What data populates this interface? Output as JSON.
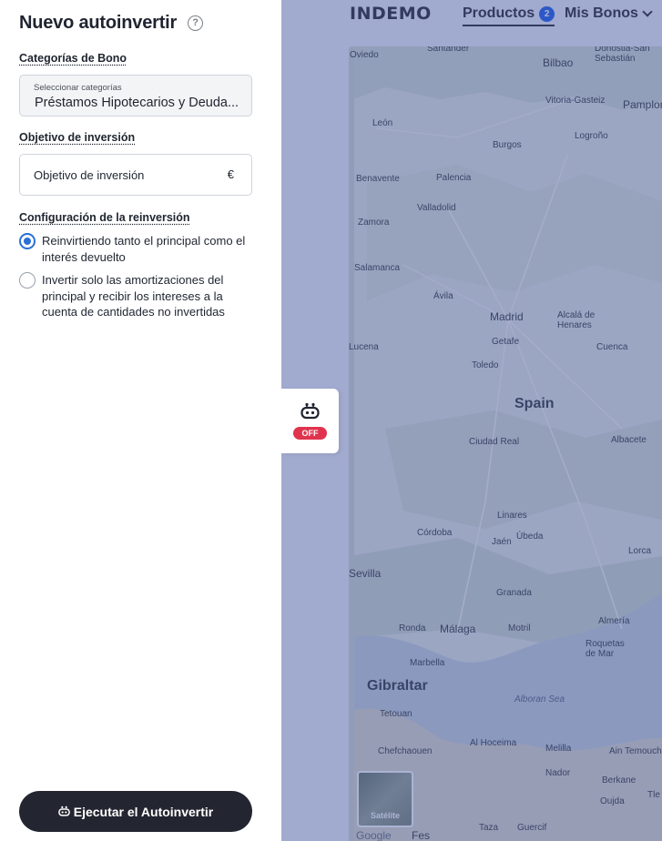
{
  "header": {
    "logo": "INDEMO",
    "nav_productos": "Productos",
    "productos_badge": "2",
    "nav_mis_bonos": "Mis Bonos"
  },
  "panel": {
    "title": "Nuevo autoinvertir",
    "help_icon": "?",
    "categorias": {
      "label": "Categorías de Bono",
      "caption": "Seleccionar categorías",
      "value": "Préstamos Hipotecarios y Deuda..."
    },
    "objetivo": {
      "label": "Objetivo de inversión",
      "placeholder": "Objetivo de inversión",
      "unit": "€"
    },
    "reinversion": {
      "label": "Configuración de la reinversión",
      "options": [
        {
          "text": "Reinvirtiendo tanto el principal como el interés devuelto",
          "selected": true
        },
        {
          "text": "Invertir solo las amortizaciones del principal y recibir los intereses a la cuenta de cantidades no invertidas",
          "selected": false
        }
      ]
    },
    "execute_button": "Ejecutar el Autoinvertir"
  },
  "bot_toggle": {
    "status": "OFF"
  },
  "map": {
    "country": "Spain",
    "satellite_label": "Satélite",
    "attribution": "Google",
    "cities": [
      "Santander",
      "Donostia-San Sebastián",
      "Oviedo",
      "Bilbao",
      "Vitoria-Gasteiz",
      "Pamplona",
      "León",
      "Logroño",
      "Burgos",
      "Benavente",
      "Palencia",
      "Valladolid",
      "Zamora",
      "Salamanca",
      "Ávila",
      "Madrid",
      "Alcalá de Henares",
      "Getafe",
      "Toledo",
      "Cuenca",
      "Ciudad Real",
      "Albacete",
      "Linares",
      "Córdoba",
      "Jaén",
      "Úbeda",
      "Lorca",
      "Sevilla",
      "Granada",
      "Ronda",
      "Málaga",
      "Motril",
      "Almería",
      "Roquetas de Mar",
      "Marbella",
      "Gibraltar",
      "Tetouan",
      "Al Hoceima",
      "Melilla",
      "Ain Temouchent",
      "Chefchaouen",
      "Nador",
      "Berkane",
      "Oujda",
      "Taza",
      "Guercif",
      "Fes",
      "Alboran Sea",
      "Tle",
      "Lucena"
    ]
  },
  "colors": {
    "accent_radio": "#2b6fd6",
    "off_badge": "#e0334e",
    "button_dark": "#232630",
    "overlay": "#374b96"
  }
}
